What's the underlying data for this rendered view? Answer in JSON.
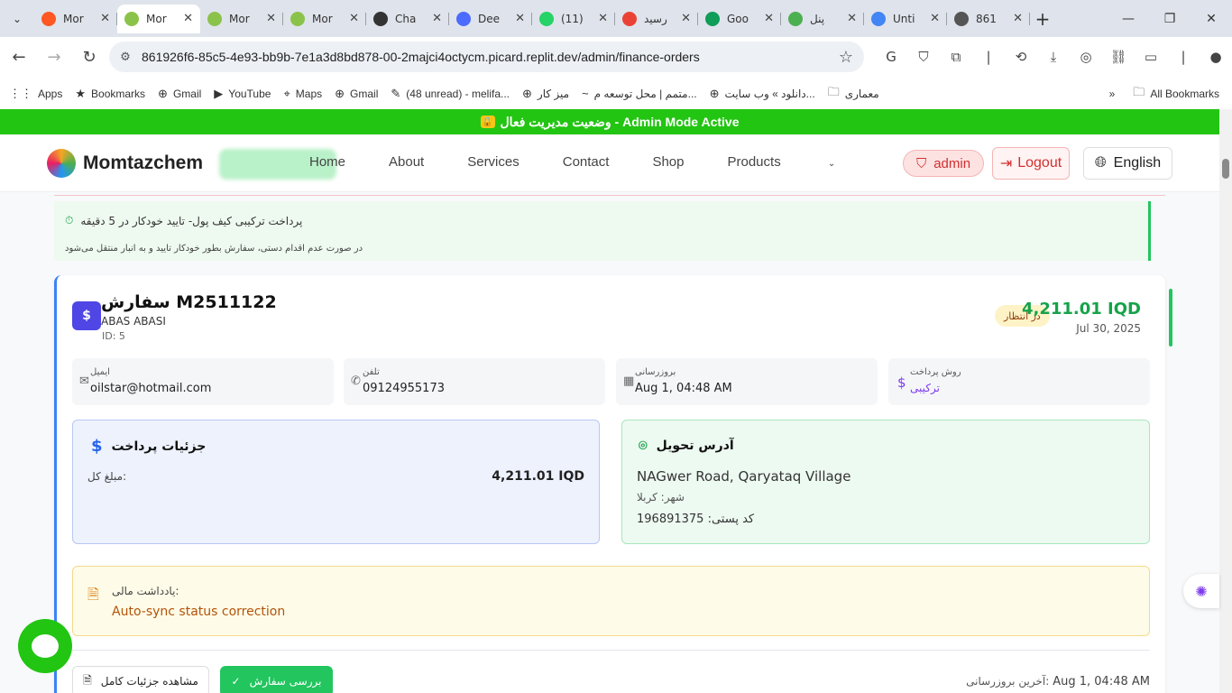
{
  "browser": {
    "tabs": [
      {
        "title": "Mor",
        "color": "#ff5722"
      },
      {
        "title": "Mor",
        "color": "#8bc34a",
        "active": true
      },
      {
        "title": "Mor",
        "color": "#8bc34a"
      },
      {
        "title": "Mor",
        "color": "#8bc34a"
      },
      {
        "title": "Cha",
        "color": "#333333"
      },
      {
        "title": "Dee",
        "color": "#4d6bfe"
      },
      {
        "title": "(11)",
        "color": "#25d366"
      },
      {
        "title": "رسید",
        "color": "#ea4335"
      },
      {
        "title": "Goo",
        "color": "#0f9d58"
      },
      {
        "title": "پنل",
        "color": "#4caf50"
      },
      {
        "title": "Unti",
        "color": "#4285f4"
      },
      {
        "title": "861",
        "color": "#555555"
      }
    ],
    "url": "861926f6-85c5-4e93-bb9b-7e1a3d8bd878-00-2majci4octycm.picard.replit.dev/admin/finance-orders",
    "bookmarks": [
      "Apps",
      "Bookmarks",
      "Gmail",
      "YouTube",
      "Maps",
      "Gmail",
      "(48 unread) - melifa...",
      "میز کار",
      "متمم | محل توسعه م...",
      "دانلود » وب سایت...",
      "معماری"
    ],
    "all_bookmarks": "All Bookmarks"
  },
  "admin_bar": "وضعیت مدیریت فعال - Admin Mode Active",
  "site": {
    "brand": "Momtazchem",
    "nav": [
      "Home",
      "About",
      "Services",
      "Contact",
      "Shop",
      "Products"
    ],
    "admin_label": "admin",
    "logout_label": "Logout",
    "lang_label": "English"
  },
  "notice": {
    "line1": "پرداخت ترکیبی کیف پول- تایید خودکار در 5 دقیقه",
    "line2": "در صورت عدم اقدام دستی، سفارش بطور خودکار تایید و به انبار منتقل می‌شود"
  },
  "order": {
    "title": "سفارش M2511122",
    "customer": "ABAS ABASI",
    "id": "ID: 5",
    "status": "در انتظار",
    "amount": "4,211.01 IQD",
    "date": "Jul 30, 2025",
    "info": {
      "email_label": "ایمیل",
      "email": "oilstar@hotmail.com",
      "phone_label": "تلفن",
      "phone": "09124955173",
      "updated_label": "بروزرسانی",
      "updated": "Aug 1, 04:48 AM",
      "method_label": "روش پرداخت",
      "method": "ترکیبی"
    },
    "payment": {
      "heading": "جزئیات پرداخت",
      "total_label": "مبلغ کل:",
      "total": "4,211.01 IQD"
    },
    "address": {
      "heading": "آدرس تحویل",
      "line": "NAGwer Road, Qaryataq Village",
      "city": "شهر: کربلا",
      "postal": "کد پستی: 196891375"
    },
    "note": {
      "title": "یادداشت مالی:",
      "text": "Auto-sync status correction"
    },
    "actions": {
      "details": "مشاهده جزئیات کامل",
      "review": "بررسی سفارش"
    },
    "last_update_label": "آخرین بروزرسانی:",
    "last_update": "Aug 1, 04:48 AM"
  }
}
